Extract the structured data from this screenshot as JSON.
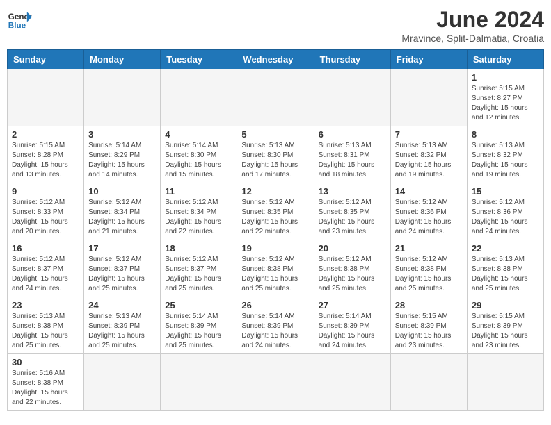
{
  "header": {
    "logo_text_regular": "General",
    "logo_text_blue": "Blue",
    "title": "June 2024",
    "subtitle": "Mravince, Split-Dalmatia, Croatia"
  },
  "weekdays": [
    "Sunday",
    "Monday",
    "Tuesday",
    "Wednesday",
    "Thursday",
    "Friday",
    "Saturday"
  ],
  "weeks": [
    [
      {
        "day": "",
        "info": ""
      },
      {
        "day": "",
        "info": ""
      },
      {
        "day": "",
        "info": ""
      },
      {
        "day": "",
        "info": ""
      },
      {
        "day": "",
        "info": ""
      },
      {
        "day": "",
        "info": ""
      },
      {
        "day": "1",
        "info": "Sunrise: 5:15 AM\nSunset: 8:27 PM\nDaylight: 15 hours and 12 minutes."
      }
    ],
    [
      {
        "day": "2",
        "info": "Sunrise: 5:15 AM\nSunset: 8:28 PM\nDaylight: 15 hours and 13 minutes."
      },
      {
        "day": "3",
        "info": "Sunrise: 5:14 AM\nSunset: 8:29 PM\nDaylight: 15 hours and 14 minutes."
      },
      {
        "day": "4",
        "info": "Sunrise: 5:14 AM\nSunset: 8:30 PM\nDaylight: 15 hours and 15 minutes."
      },
      {
        "day": "5",
        "info": "Sunrise: 5:13 AM\nSunset: 8:30 PM\nDaylight: 15 hours and 17 minutes."
      },
      {
        "day": "6",
        "info": "Sunrise: 5:13 AM\nSunset: 8:31 PM\nDaylight: 15 hours and 18 minutes."
      },
      {
        "day": "7",
        "info": "Sunrise: 5:13 AM\nSunset: 8:32 PM\nDaylight: 15 hours and 19 minutes."
      },
      {
        "day": "8",
        "info": "Sunrise: 5:13 AM\nSunset: 8:32 PM\nDaylight: 15 hours and 19 minutes."
      }
    ],
    [
      {
        "day": "9",
        "info": "Sunrise: 5:12 AM\nSunset: 8:33 PM\nDaylight: 15 hours and 20 minutes."
      },
      {
        "day": "10",
        "info": "Sunrise: 5:12 AM\nSunset: 8:34 PM\nDaylight: 15 hours and 21 minutes."
      },
      {
        "day": "11",
        "info": "Sunrise: 5:12 AM\nSunset: 8:34 PM\nDaylight: 15 hours and 22 minutes."
      },
      {
        "day": "12",
        "info": "Sunrise: 5:12 AM\nSunset: 8:35 PM\nDaylight: 15 hours and 22 minutes."
      },
      {
        "day": "13",
        "info": "Sunrise: 5:12 AM\nSunset: 8:35 PM\nDaylight: 15 hours and 23 minutes."
      },
      {
        "day": "14",
        "info": "Sunrise: 5:12 AM\nSunset: 8:36 PM\nDaylight: 15 hours and 24 minutes."
      },
      {
        "day": "15",
        "info": "Sunrise: 5:12 AM\nSunset: 8:36 PM\nDaylight: 15 hours and 24 minutes."
      }
    ],
    [
      {
        "day": "16",
        "info": "Sunrise: 5:12 AM\nSunset: 8:37 PM\nDaylight: 15 hours and 24 minutes."
      },
      {
        "day": "17",
        "info": "Sunrise: 5:12 AM\nSunset: 8:37 PM\nDaylight: 15 hours and 25 minutes."
      },
      {
        "day": "18",
        "info": "Sunrise: 5:12 AM\nSunset: 8:37 PM\nDaylight: 15 hours and 25 minutes."
      },
      {
        "day": "19",
        "info": "Sunrise: 5:12 AM\nSunset: 8:38 PM\nDaylight: 15 hours and 25 minutes."
      },
      {
        "day": "20",
        "info": "Sunrise: 5:12 AM\nSunset: 8:38 PM\nDaylight: 15 hours and 25 minutes."
      },
      {
        "day": "21",
        "info": "Sunrise: 5:12 AM\nSunset: 8:38 PM\nDaylight: 15 hours and 25 minutes."
      },
      {
        "day": "22",
        "info": "Sunrise: 5:13 AM\nSunset: 8:38 PM\nDaylight: 15 hours and 25 minutes."
      }
    ],
    [
      {
        "day": "23",
        "info": "Sunrise: 5:13 AM\nSunset: 8:38 PM\nDaylight: 15 hours and 25 minutes."
      },
      {
        "day": "24",
        "info": "Sunrise: 5:13 AM\nSunset: 8:39 PM\nDaylight: 15 hours and 25 minutes."
      },
      {
        "day": "25",
        "info": "Sunrise: 5:14 AM\nSunset: 8:39 PM\nDaylight: 15 hours and 25 minutes."
      },
      {
        "day": "26",
        "info": "Sunrise: 5:14 AM\nSunset: 8:39 PM\nDaylight: 15 hours and 24 minutes."
      },
      {
        "day": "27",
        "info": "Sunrise: 5:14 AM\nSunset: 8:39 PM\nDaylight: 15 hours and 24 minutes."
      },
      {
        "day": "28",
        "info": "Sunrise: 5:15 AM\nSunset: 8:39 PM\nDaylight: 15 hours and 23 minutes."
      },
      {
        "day": "29",
        "info": "Sunrise: 5:15 AM\nSunset: 8:39 PM\nDaylight: 15 hours and 23 minutes."
      }
    ],
    [
      {
        "day": "30",
        "info": "Sunrise: 5:16 AM\nSunset: 8:38 PM\nDaylight: 15 hours and 22 minutes."
      },
      {
        "day": "",
        "info": ""
      },
      {
        "day": "",
        "info": ""
      },
      {
        "day": "",
        "info": ""
      },
      {
        "day": "",
        "info": ""
      },
      {
        "day": "",
        "info": ""
      },
      {
        "day": "",
        "info": ""
      }
    ]
  ]
}
